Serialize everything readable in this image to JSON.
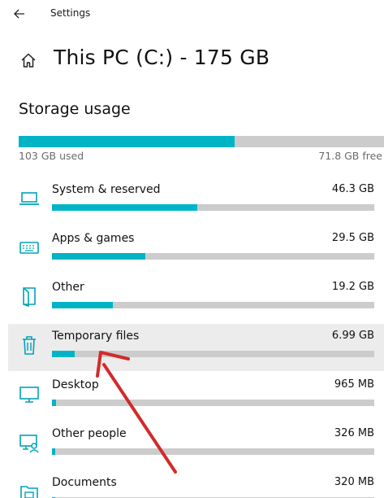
{
  "titlebar": {
    "title": "Settings",
    "back_icon": "back-arrow-icon"
  },
  "header": {
    "title": "This PC (C:) - 175 GB",
    "icon": "home-icon"
  },
  "storage": {
    "section_title": "Storage usage",
    "used_label": "103 GB used",
    "free_label": "71.8 GB free",
    "used_fraction": 0.59
  },
  "categories": [
    {
      "label": "System & reserved",
      "size": "46.3 GB",
      "fraction": 0.45,
      "icon": "laptop-icon"
    },
    {
      "label": "Apps & games",
      "size": "29.5 GB",
      "fraction": 0.29,
      "icon": "keyboard-icon"
    },
    {
      "label": "Other",
      "size": "19.2 GB",
      "fraction": 0.19,
      "icon": "folder-icon"
    },
    {
      "label": "Temporary files",
      "size": "6.99 GB",
      "fraction": 0.07,
      "icon": "trash-icon"
    },
    {
      "label": "Desktop",
      "size": "965 MB",
      "fraction": 0.012,
      "icon": "monitor-icon"
    },
    {
      "label": "Other people",
      "size": "326 MB",
      "fraction": 0.005,
      "icon": "user-monitor-icon"
    },
    {
      "label": "Documents",
      "size": "320 MB",
      "fraction": 0.005,
      "icon": "documents-icon"
    }
  ],
  "colors": {
    "accent": "#00b4c5",
    "bar_background": "#cccccc",
    "highlight": "#ececec",
    "annotation_arrow": "#d42a2a"
  }
}
